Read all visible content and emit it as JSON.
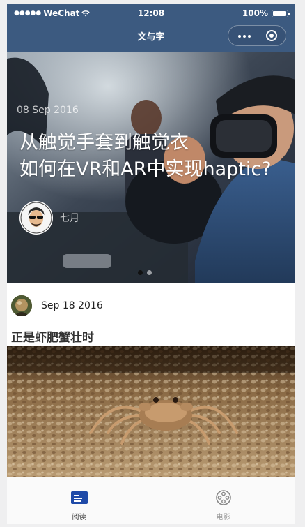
{
  "status_bar": {
    "carrier": "WeChat",
    "signal_dots": "●●●●●",
    "time": "12:08",
    "battery": "100%"
  },
  "nav": {
    "title": "文与字"
  },
  "banner": {
    "date": "08 Sep 2016",
    "title_line1": "从触觉手套到触觉衣",
    "title_line2": "如何在VR和AR中实现haptic?",
    "author": "七月",
    "slide_count": 2,
    "active_slide": 1
  },
  "post": {
    "date": "Sep 18 2016",
    "title": "正是虾肥蟹壮时"
  },
  "tabbar": {
    "tabs": [
      {
        "label": "阅读",
        "icon": "book-icon",
        "active": true
      },
      {
        "label": "电影",
        "icon": "film-reel-icon",
        "active": false
      }
    ]
  },
  "colors": {
    "nav_bg": "#3c5a80",
    "accent": "#1f4aa8",
    "tab_inactive": "#999999"
  }
}
